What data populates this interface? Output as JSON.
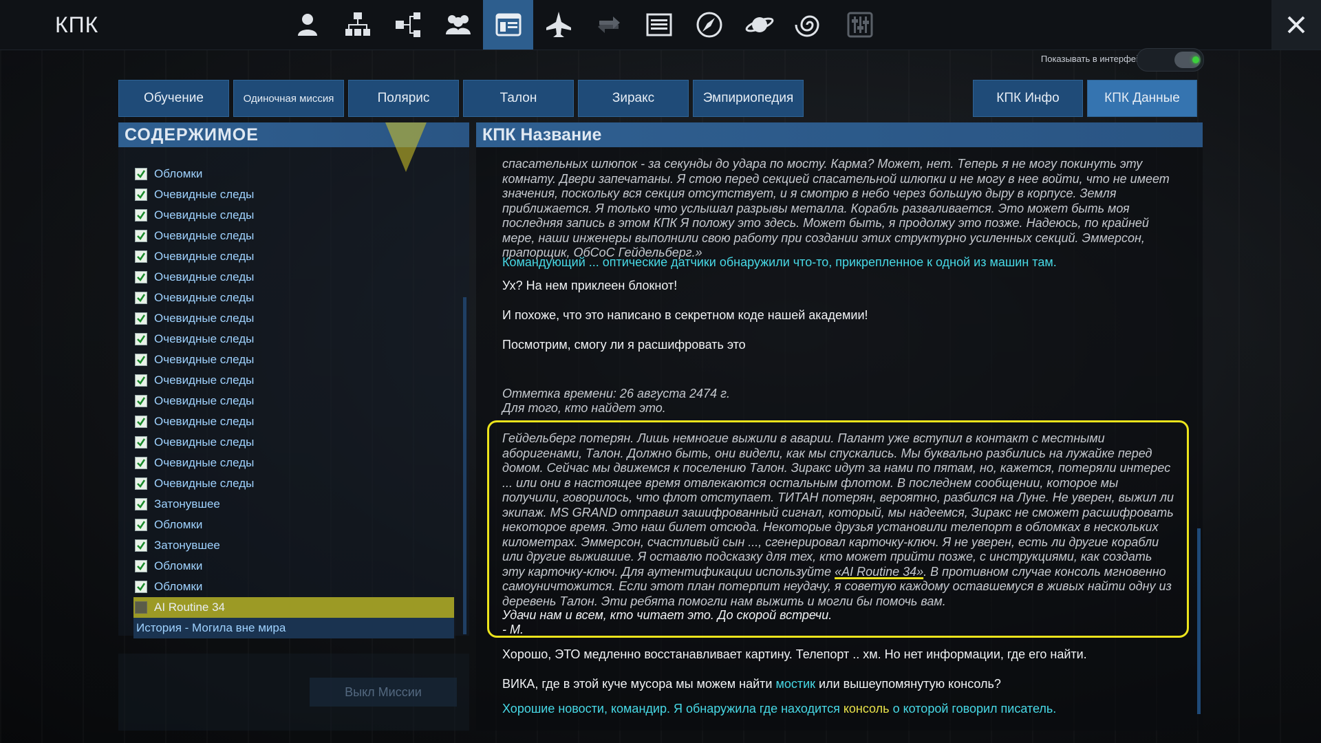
{
  "app": {
    "title": "КПК",
    "close_icon": "close-icon"
  },
  "top_icons": [
    {
      "name": "profile-icon",
      "active": false
    },
    {
      "name": "hierarchy-icon",
      "active": false
    },
    {
      "name": "network-icon",
      "active": false
    },
    {
      "name": "crew-icon",
      "active": false
    },
    {
      "name": "pda-browser-icon",
      "active": true
    },
    {
      "name": "ship-icon",
      "active": false
    },
    {
      "name": "swap-icon",
      "active": false
    },
    {
      "name": "list-icon",
      "active": false
    },
    {
      "name": "compass-icon",
      "active": false
    },
    {
      "name": "planet-icon",
      "active": false
    },
    {
      "name": "galaxy-icon",
      "active": false
    },
    {
      "name": "settings-sliders-icon",
      "active": false
    }
  ],
  "header_toggle": {
    "label": "Показывать в интерфейсе",
    "on": true
  },
  "tabs": [
    "Обучение",
    "Одиночная миссия",
    "Полярис",
    "Талон",
    "Зиракс",
    "Эмпириопедия"
  ],
  "tabs_right": [
    {
      "label": "КПК Инфо",
      "active": false
    },
    {
      "label": "КПК Данные",
      "active": true
    }
  ],
  "contents": {
    "title": "СОДЕРЖИМОЕ",
    "items": [
      "Обломки",
      "Очевидные следы",
      "Очевидные следы",
      "Очевидные следы",
      "Очевидные следы",
      "Очевидные следы",
      "Очевидные следы",
      "Очевидные следы",
      "Очевидные следы",
      "Очевидные следы",
      "Очевидные следы",
      "Очевидные следы",
      "Очевидные следы",
      "Очевидные следы",
      "Очевидные следы",
      "Очевидные следы",
      "Затонувшее",
      "Обломки",
      "Затонувшее",
      "Обломки",
      "Обломки"
    ],
    "selected_item": "AI Routine 34",
    "story_item": "История - Могила вне мира",
    "mission_off_button": "Выкл Миссии"
  },
  "pda": {
    "title": "КПК Название",
    "p1": "спасательных шлюпок - за секунды до удара по мосту. Карма? Может, нет. Теперь я не могу покинуть эту комнату. Двери запечатаны. Я стою перед секцией спасательной шлюпки и не могу в нее войти, что не имеет значения, поскольку вся секция отсутствует, и я смотрю в небо через большую дыру в корпусе. Земля приближается. Я только что услышал разрывы металла. Корабль разваливается. Это может быть моя последняя запись в этом КПК Я положу это здесь. Может быть, я продолжу это позже. Надеюсь, по крайней мере, наши инженеры выполнили свою работу при создании этих структурно усиленных секций. Эммерсон, прапорщик, ОбСоС Гейдельберг.»",
    "p2": "Командующий ... оптические датчики обнаружили что-то, прикрепленное к одной из машин там.",
    "p3": "Ух? На нем приклеен блокнот!",
    "p4": "И похоже, что это написано в секретном коде нашей академии!",
    "p5": "Посмотрим, смогу ли я расшифровать это",
    "p6a": "Отметка времени: 26 августа 2474 г.",
    "p6b": "Для того, кто найдет это.",
    "p7": "Гейдельберг потерян. Лишь немногие выжили в аварии. Палант уже вступил в контакт с местными аборигенами, Талон. Должно быть, они видели, как мы спускались. Мы буквально разбились на лужайке перед домом. Сейчас мы движемся к поселению Талон. Зиракс идут за нами по пятам, но, кажется, потеряли интерес ... или они в настоящее время отвлекаются остальным флотом. В последнем сообщении, которое мы получили, говорилось, что флот отступает. ТИТАН потерян, вероятно, разбился на Луне. Не уверен, выжил ли экипаж. MS GRAND отправил зашифрованный сигнал, который, мы надеемся, Зиракс не сможет расшифровать некоторое время. Это наш билет отсюда. Некоторые друзья установили телепорт в обломках в нескольких километрах. Эммерсон, счастливый сын ..., сгенерировал карточку-ключ. Я не уверен, есть ли другие корабли или другие выжившие. Я оставлю подсказку для тех, кто может прийти позже, с инструкциями, как создать эту карточку-ключ. Для аутентификации используйте",
    "p7_code": "«AI Routine 34»",
    "p7_tail": ". В противном случае консоль мгновенно самоуничтожится. Если этот план потерпит неудачу, я советую каждому оставшемуся в живых найти одну из деревень Талон. Эти ребята помогли нам выжить и могли бы помочь вам.",
    "p8": "Удачи нам и всем, кто читает это. До скорой встречи.",
    "p9": "- М.",
    "p10": "Хорошо, ЭТО медленно восстанавливает картину. Телепорт .. хм. Но нет информации, где его найти.",
    "p11a": "ВИКА, где в этой куче мусора мы можем найти ",
    "p11_link": "мостик",
    "p11b": " или вышеупомянутую консоль?",
    "p12a": "Хорошие новости, командир. Я обнаружила где находится ",
    "p12_link": "консоль",
    "p12b": " о которой говорил писатель."
  }
}
